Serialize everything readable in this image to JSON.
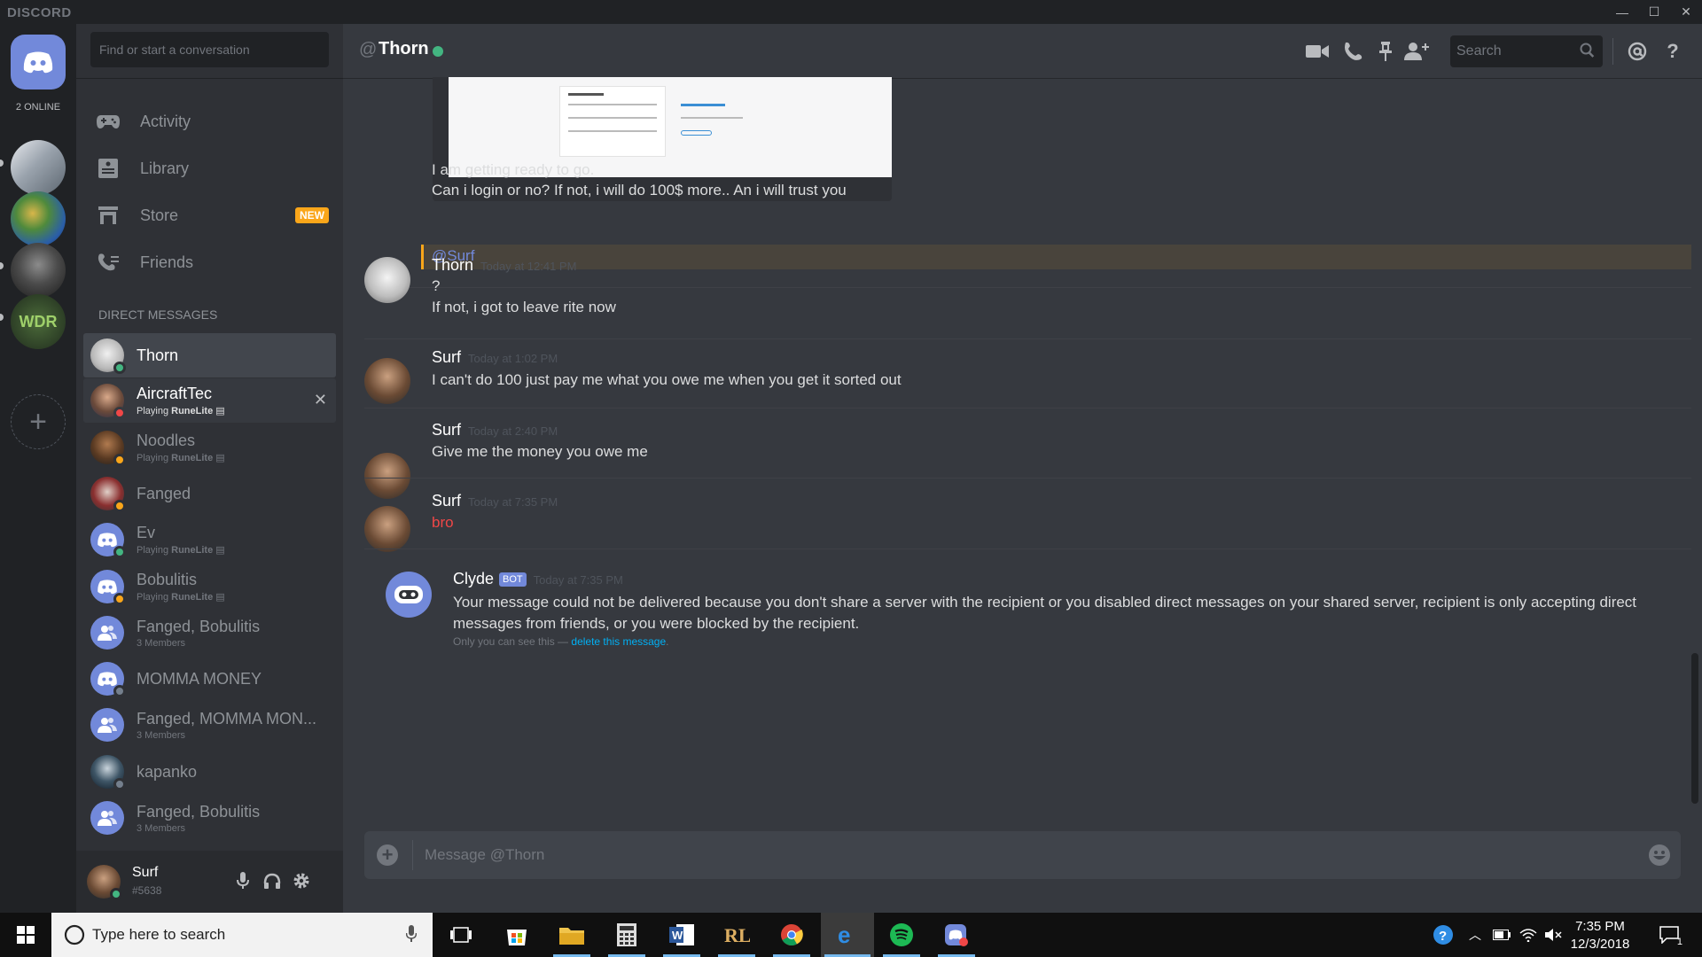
{
  "window": {
    "brand": "DISCORD",
    "controls": [
      "—",
      "☐",
      "✕"
    ]
  },
  "guilds": {
    "online_count": "2 ONLINE",
    "items": [
      "home",
      "server-1",
      "server-2",
      "server-3",
      "server-wdr"
    ],
    "add_label": "+"
  },
  "sidebar": {
    "search_placeholder": "Find or start a conversation",
    "nav": [
      {
        "label": "Activity",
        "icon": "gamepad-icon"
      },
      {
        "label": "Library",
        "icon": "library-icon"
      },
      {
        "label": "Store",
        "icon": "store-icon",
        "badge": "NEW"
      },
      {
        "label": "Friends",
        "icon": "friends-icon"
      }
    ],
    "dm_header": "DIRECT MESSAGES",
    "dms": [
      {
        "name": "Thorn",
        "sub": "",
        "status": "#43b581"
      },
      {
        "name": "AircraftTec",
        "sub_prefix": "Playing ",
        "sub_game": "RuneLite",
        "status": "#f04747"
      },
      {
        "name": "Noodles",
        "sub_prefix": "Playing ",
        "sub_game": "RuneLite",
        "status": "#faa61a"
      },
      {
        "name": "Fanged",
        "sub": "",
        "status": "#faa61a"
      },
      {
        "name": "Ev",
        "sub_prefix": "Playing ",
        "sub_game": "RuneLite",
        "status": "#43b581"
      },
      {
        "name": "Bobulitis",
        "sub_prefix": "Playing ",
        "sub_game": "RuneLite",
        "status": "#faa61a"
      },
      {
        "name": "Fanged, Bobulitis",
        "sub": "3 Members"
      },
      {
        "name": "MOMMA MONEY",
        "sub": "",
        "status": "#747f8d"
      },
      {
        "name": "Fanged, MOMMA MON...",
        "sub": "3 Members"
      },
      {
        "name": "kapanko",
        "sub": "",
        "status": "#747f8d"
      },
      {
        "name": "Fanged, Bobulitis",
        "sub": "3 Members"
      }
    ]
  },
  "user": {
    "name": "Surf",
    "tag": "#5638",
    "status": "#43b581"
  },
  "header": {
    "at": "@",
    "name": "Thorn",
    "search_placeholder": "Search"
  },
  "messages": {
    "continued": [
      "I am getting ready to go.",
      "Can i login or no? If not, i will do 100$ more.. An i will trust you"
    ],
    "mention": "@Surf",
    "groups": [
      {
        "author": "Thorn",
        "time": "Today at 12:41 PM",
        "lines": [
          "?",
          "If not, i got to leave rite now"
        ]
      },
      {
        "author": "Surf",
        "time": "Today at 1:02 PM",
        "lines": [
          "I can't do 100 just pay me what you owe me when you get it sorted out"
        ]
      },
      {
        "author": "Surf",
        "time": "Today at 2:40 PM",
        "lines": [
          "Give me the money you owe me"
        ]
      },
      {
        "author": "Surf",
        "time": "Today at 7:35 PM",
        "lines": [
          "bro"
        ]
      }
    ],
    "clyde": {
      "author": "Clyde",
      "badge": "BOT",
      "time": "Today at 7:35 PM",
      "text": "Your message could not be delivered because you don't share a server with the recipient or you disabled direct messages on your shared server, recipient is only accepting direct messages from friends, or you were blocked by the recipient.",
      "note_prefix": "Only you can see this — ",
      "note_link": "delete this message",
      "note_suffix": "."
    }
  },
  "composer": {
    "placeholder": "Message @Thorn"
  },
  "taskbar": {
    "search_placeholder": "Type here to search",
    "time": "7:35 PM",
    "date": "12/3/2018",
    "notifications": "1"
  }
}
